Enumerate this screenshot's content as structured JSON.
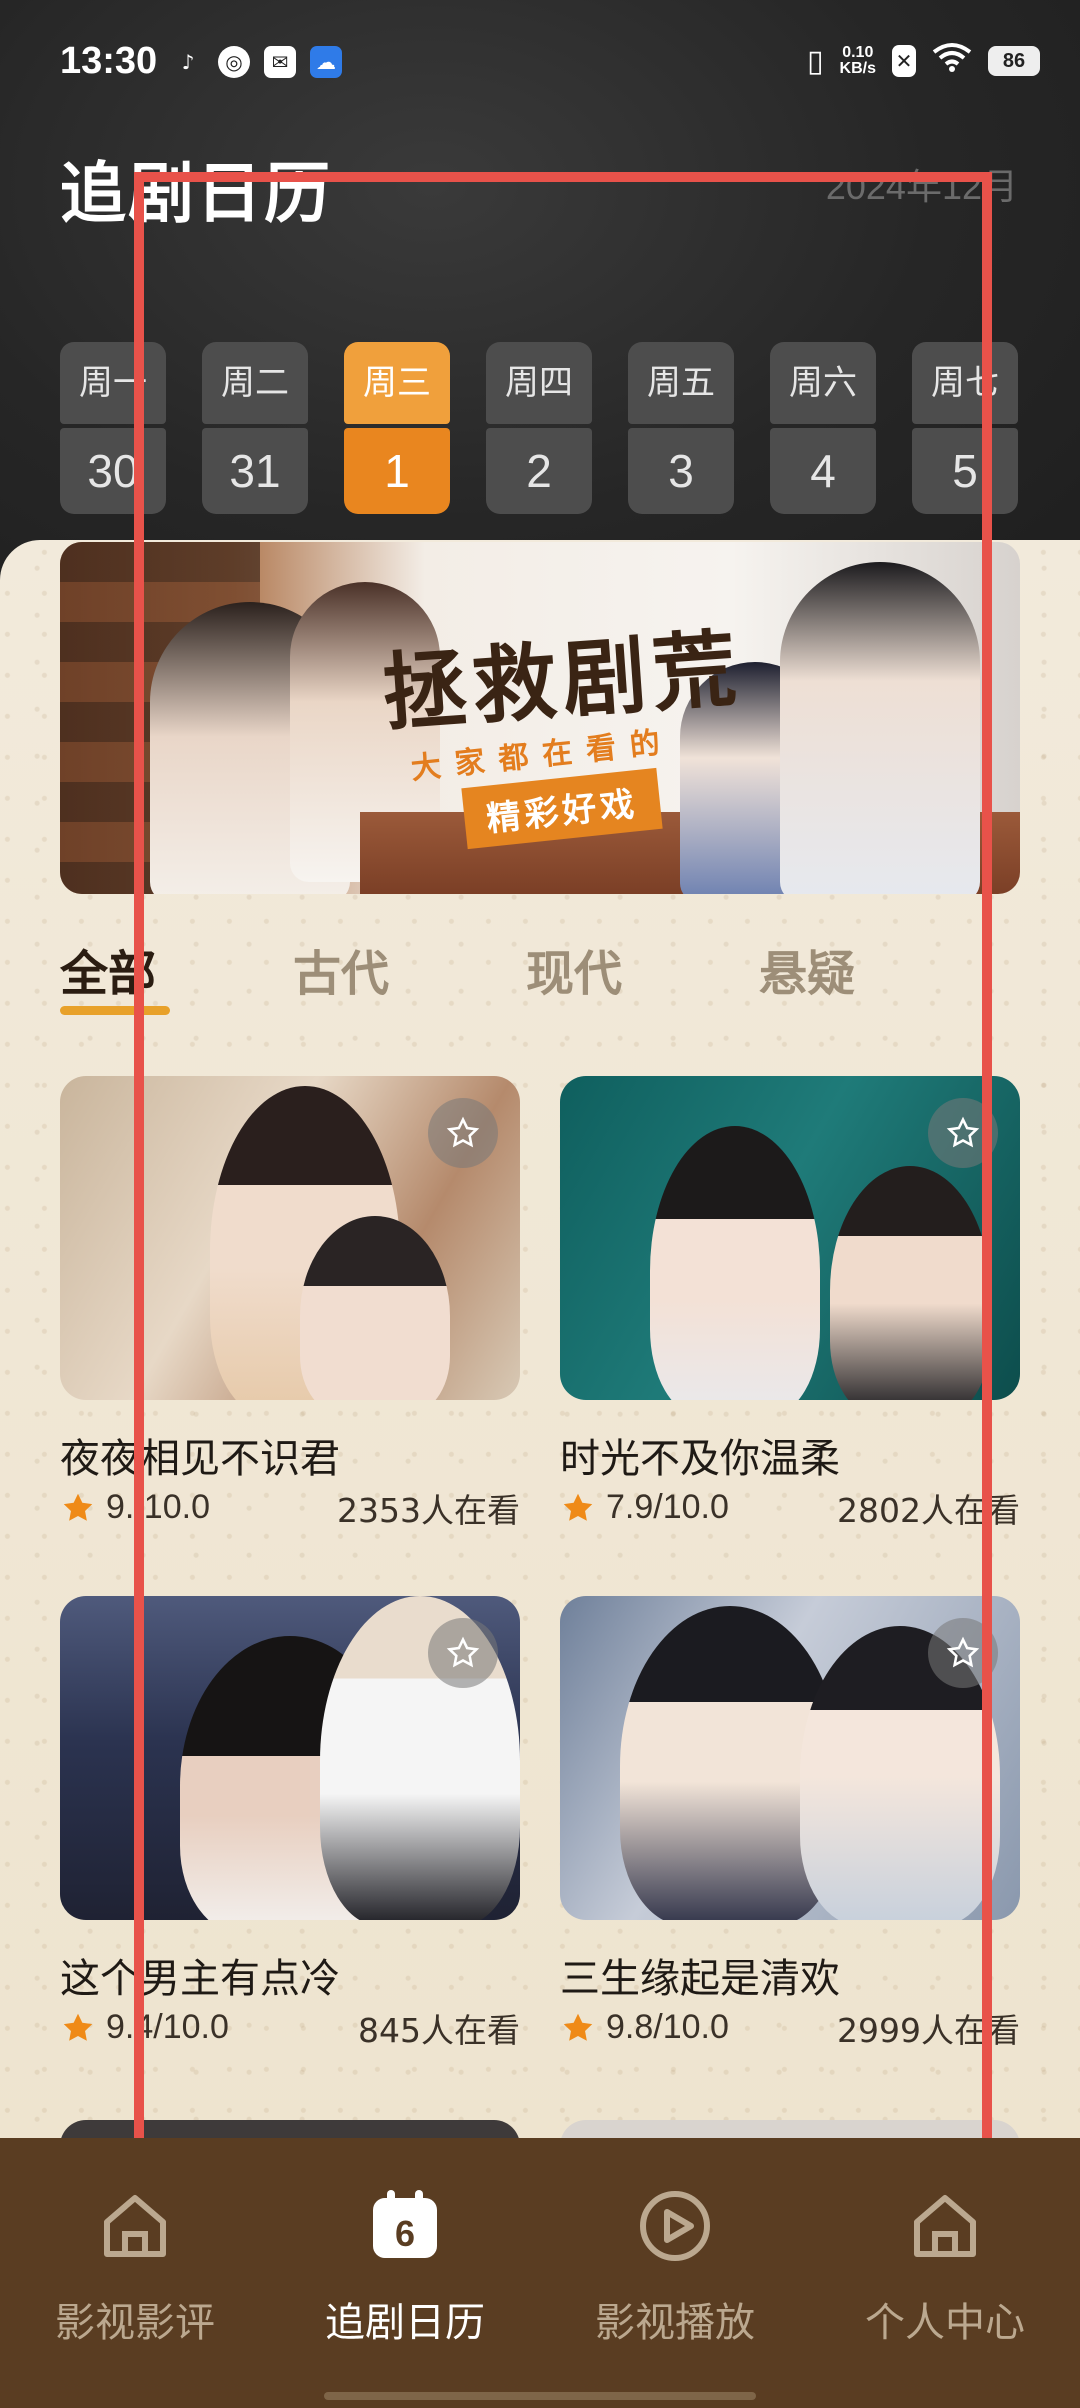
{
  "status_bar": {
    "time": "13:30",
    "net_speed_value": "0.10",
    "net_speed_unit": "KB/s",
    "battery": "86"
  },
  "header": {
    "title": "追剧日历",
    "month": "2024年12月"
  },
  "week": [
    {
      "weekday": "周一",
      "date": "30",
      "selected": false
    },
    {
      "weekday": "周二",
      "date": "31",
      "selected": false
    },
    {
      "weekday": "周三",
      "date": "1",
      "selected": true
    },
    {
      "weekday": "周四",
      "date": "2",
      "selected": false
    },
    {
      "weekday": "周五",
      "date": "3",
      "selected": false
    },
    {
      "weekday": "周六",
      "date": "4",
      "selected": false
    },
    {
      "weekday": "周七",
      "date": "5",
      "selected": false
    }
  ],
  "banner": {
    "title": "拯救剧荒",
    "subtitle": "大家都在看的",
    "pill": "精彩好戏"
  },
  "tabs": [
    "全部",
    "古代",
    "现代",
    "悬疑"
  ],
  "active_tab": "全部",
  "cards": [
    {
      "title": "夜夜相见不识君",
      "rating": "9./10.0",
      "watching": "2353人在看"
    },
    {
      "title": "时光不及你温柔",
      "rating": "7.9/10.0",
      "watching": "2802人在看"
    },
    {
      "title": "这个男主有点冷",
      "rating": "9.4/10.0",
      "watching": "845人在看"
    },
    {
      "title": "三生缘起是清欢",
      "rating": "9.8/10.0",
      "watching": "2999人在看"
    }
  ],
  "bottom_nav": [
    {
      "label": "影视影评",
      "icon": "home-icon",
      "active": false
    },
    {
      "label": "追剧日历",
      "icon": "calendar-icon",
      "active": true,
      "badge": "6"
    },
    {
      "label": "影视播放",
      "icon": "play-circle-icon",
      "active": false
    },
    {
      "label": "个人中心",
      "icon": "home-icon",
      "active": false
    }
  ],
  "colors": {
    "accent": "#e9861f",
    "nav_bg": "#5a3d22",
    "selection_frame": "#e8524a"
  }
}
